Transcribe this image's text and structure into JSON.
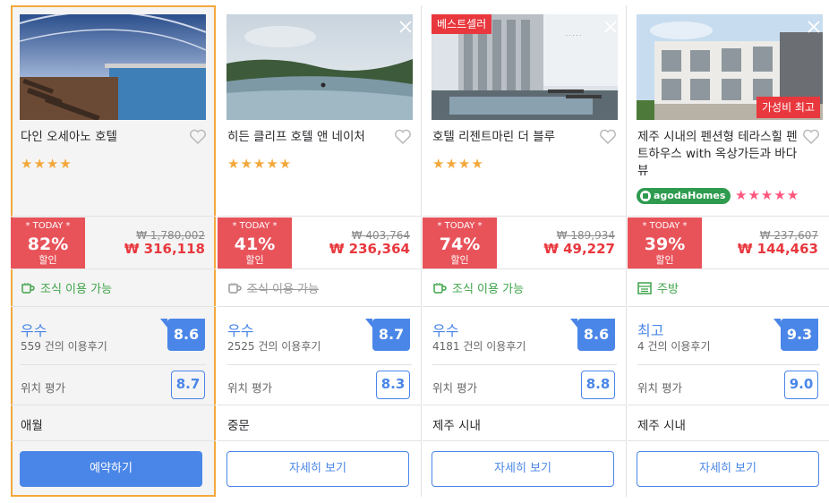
{
  "colors": {
    "accent": "#4a86e8",
    "deal_red": "#e8535a",
    "price_red": "#e8383e",
    "highlight_border": "#f3a83b",
    "amenity_green": "#3fa44a",
    "star_orange": "#f3a83b",
    "star_pink": "#ff567d"
  },
  "hotels": [
    {
      "name": "다인 오세아노 호텔",
      "stars": "★★★★",
      "star_count": 4,
      "badge_today": "* TODAY *",
      "discount_pct": "82%",
      "discount_label": "할인",
      "old_price": "₩ 1,780,002",
      "new_price": "₩ 316,118",
      "amenity": "조식 이용 가능",
      "amenity_available": true,
      "rating_word": "우수",
      "review_count": "559 건의 이용후기",
      "score": "8.6",
      "location_label": "위치 평가",
      "location_score": "8.7",
      "area": "애월",
      "button_label": "예약하기",
      "photo_icon": "pool-photo"
    },
    {
      "name": "히든 클리프 호텔 앤 네이처",
      "stars": "★★★★★",
      "star_count": 5,
      "badge_today": "* TODAY *",
      "discount_pct": "41%",
      "discount_label": "할인",
      "old_price": "₩ 403,764",
      "new_price": "₩ 236,364",
      "amenity": "조식 이용 가능",
      "amenity_available": false,
      "rating_word": "우수",
      "review_count": "2525 건의 이용후기",
      "score": "8.7",
      "location_label": "위치 평가",
      "location_score": "8.3",
      "area": "중문",
      "button_label": "자세히 보기",
      "photo_icon": "infinity-pool-photo"
    },
    {
      "name": "호텔 리젠트마린 더 블루",
      "stars": "★★★★",
      "star_count": 4,
      "tag": "베스트셀러",
      "badge_today": "* TODAY *",
      "discount_pct": "74%",
      "discount_label": "할인",
      "old_price": "₩ 189,934",
      "new_price": "₩ 49,227",
      "amenity": "조식 이용 가능",
      "amenity_available": true,
      "rating_word": "우수",
      "review_count": "4181 건의 이용후기",
      "score": "8.6",
      "location_label": "위치 평가",
      "location_score": "8.8",
      "area": "제주 시내",
      "button_label": "자세히 보기",
      "photo_icon": "building-photo"
    },
    {
      "name": "제주 시내의 펜션형 테라스힐 펜트하우스 with 옥상가든과 바다뷰",
      "stars": "★★★★★",
      "star_count": 5,
      "tag": "가성비 최고",
      "homes_label": "agodaHomes",
      "badge_today": "* TODAY *",
      "discount_pct": "39%",
      "discount_label": "할인",
      "old_price": "₩ 237,607",
      "new_price": "₩ 144,463",
      "amenity": "주방",
      "amenity_available": true,
      "rating_word": "최고",
      "review_count": "4 건의 이용후기",
      "score": "9.3",
      "location_label": "위치 평가",
      "location_score": "9.0",
      "area": "제주 시내",
      "button_label": "자세히 보기",
      "photo_icon": "townhouse-photo"
    }
  ]
}
